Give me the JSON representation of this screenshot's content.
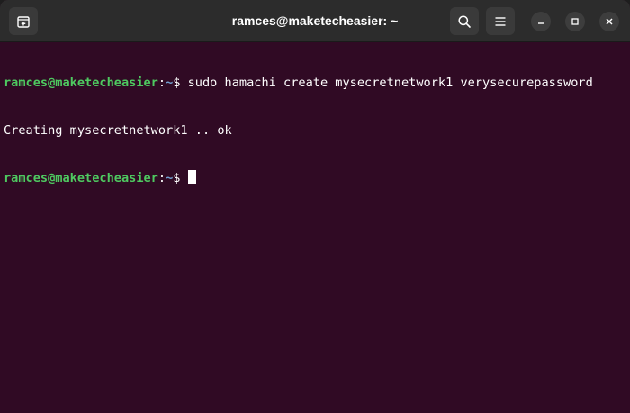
{
  "window": {
    "title": "ramces@maketecheasier: ~"
  },
  "titlebar": {
    "new_tab_icon": "new-tab-icon",
    "search_icon": "search-icon",
    "menu_icon": "hamburger-menu-icon",
    "minimize_icon": "minimize-icon",
    "maximize_icon": "maximize-icon",
    "close_icon": "close-icon"
  },
  "terminal": {
    "lines": [
      {
        "user_host": "ramces@maketecheasier",
        "separator": ":",
        "path": "~",
        "prompt": "$ ",
        "command": "sudo hamachi create mysecretnetwork1 verysecurepassword"
      },
      {
        "output": "Creating mysecretnetwork1 .. ok"
      },
      {
        "user_host": "ramces@maketecheasier",
        "separator": ":",
        "path": "~",
        "prompt": "$ ",
        "command": ""
      }
    ]
  },
  "colors": {
    "background": "#300a24",
    "user_host": "#4ec960",
    "path": "#729fcf",
    "text": "#ffffff",
    "titlebar": "#2c2c2c"
  }
}
